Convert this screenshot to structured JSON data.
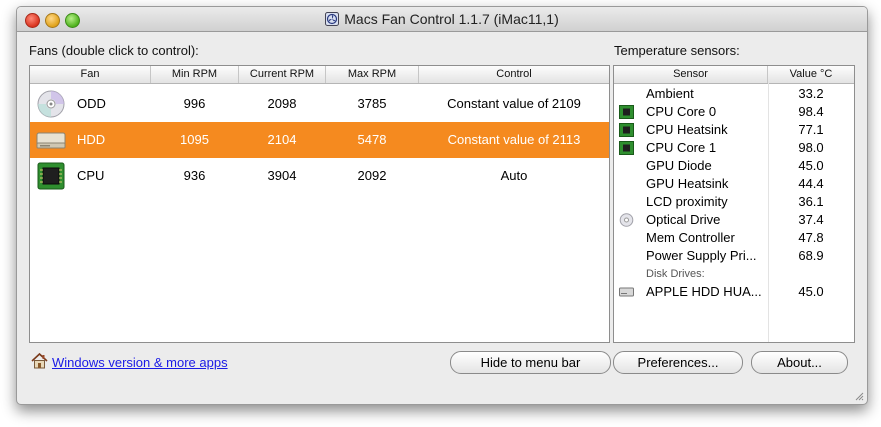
{
  "window": {
    "title": "Macs Fan Control 1.1.7 (iMac11,1)"
  },
  "fans": {
    "section_label": "Fans (double click to control):",
    "columns": [
      "Fan",
      "Min RPM",
      "Current RPM",
      "Max RPM",
      "Control"
    ],
    "rows": [
      {
        "name": "ODD",
        "icon": "optical-disc-icon",
        "min": "996",
        "current": "2098",
        "max": "3785",
        "control": "Constant value of 2109",
        "selected": false
      },
      {
        "name": "HDD",
        "icon": "hard-drive-icon",
        "min": "1095",
        "current": "2104",
        "max": "5478",
        "control": "Constant value of 2113",
        "selected": true
      },
      {
        "name": "CPU",
        "icon": "cpu-chip-icon",
        "min": "936",
        "current": "3904",
        "max": "2092",
        "control": "Auto",
        "selected": false
      }
    ],
    "selection_color": "#f58a1f"
  },
  "sensors": {
    "section_label": "Temperature sensors:",
    "columns": [
      "Sensor",
      "Value °C"
    ],
    "rows": [
      {
        "name": "Ambient",
        "value": "33.2",
        "icon": ""
      },
      {
        "name": "CPU Core 0",
        "value": "98.4",
        "icon": "cpu-chip-icon"
      },
      {
        "name": "CPU Heatsink",
        "value": "77.1",
        "icon": "cpu-chip-icon"
      },
      {
        "name": "CPU Core 1",
        "value": "98.0",
        "icon": "cpu-chip-icon"
      },
      {
        "name": "GPU Diode",
        "value": "45.0",
        "icon": ""
      },
      {
        "name": "GPU Heatsink",
        "value": "44.4",
        "icon": ""
      },
      {
        "name": "LCD proximity",
        "value": "36.1",
        "icon": ""
      },
      {
        "name": "Optical Drive",
        "value": "37.4",
        "icon": "optical-disc-icon"
      },
      {
        "name": "Mem Controller",
        "value": "47.8",
        "icon": ""
      },
      {
        "name": "Power Supply Pri...",
        "value": "68.9",
        "icon": ""
      }
    ],
    "disk_group_label": "Disk Drives:",
    "disk_rows": [
      {
        "name": "APPLE HDD HUA...",
        "value": "45.0",
        "icon": "hard-drive-icon"
      }
    ]
  },
  "footer": {
    "link_text": "Windows version & more apps",
    "hide_button": "Hide to menu bar",
    "preferences_button": "Preferences...",
    "about_button": "About..."
  }
}
